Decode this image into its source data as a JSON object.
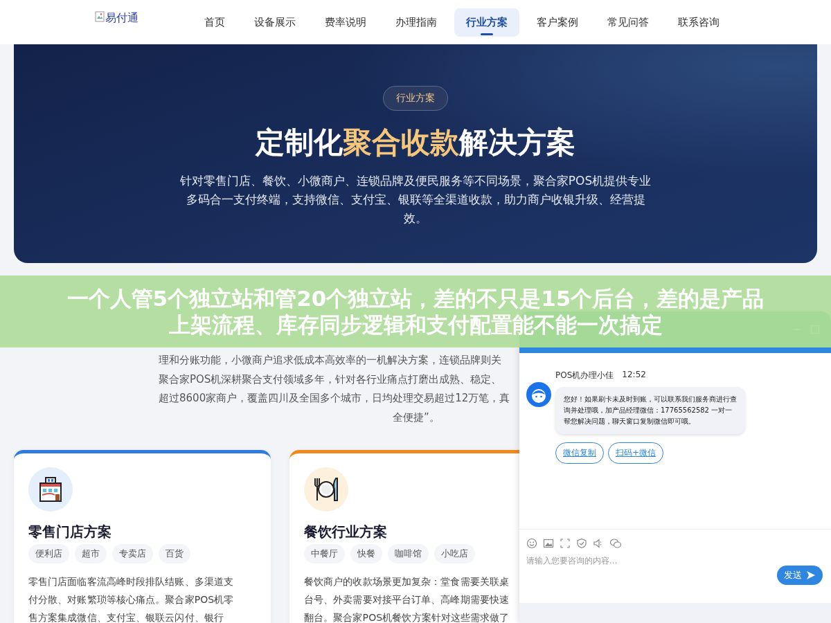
{
  "nav": {
    "logo": "易付通",
    "items": [
      {
        "label": "首页",
        "selected": false
      },
      {
        "label": "设备展示",
        "selected": false
      },
      {
        "label": "费率说明",
        "selected": false
      },
      {
        "label": "办理指南",
        "selected": false
      },
      {
        "label": "行业方案",
        "selected": true
      },
      {
        "label": "客户案例",
        "selected": false
      },
      {
        "label": "常见问答",
        "selected": false
      },
      {
        "label": "联系咨询",
        "selected": false
      }
    ]
  },
  "hero": {
    "badge": "行业方案",
    "title": {
      "before": "定制化",
      "highlight": "聚合收款",
      "after": "解决方案"
    },
    "description": "针对零售门店、餐饮、小微商户、连锁品牌及便民服务等不同场景，聚合家POS机提供专业多码合一支付终端，支持微信、支付宝、银联等全渠道收款，助力商户收银升级、经营提效。"
  },
  "intro": {
    "lines": [
      "理和分账功能，小微商户追求低成本高效率的一机解决方案，连锁品牌则关",
      "聚合家POS机深耕聚合支付领域多年，针对各行业痛点打磨出成熟、稳定、",
      "超过8600家商户，覆盖四川及全国多个城市，日均处理交易超过12万笔，真",
      "全便捷”。"
    ]
  },
  "cards": [
    {
      "kind": "retail",
      "color": "#2f7be0",
      "title": "零售门店方案",
      "tags": [
        "便利店",
        "超市",
        "专卖店",
        "百货"
      ],
      "lines": [
        "零售门店面临客流高峰时段排队结账、多渠道支",
        "付分散、对账繁琐等核心痛点。聚合家POS机零",
        "售方案集成微信、支付宝、银联云闪付、银行"
      ]
    },
    {
      "kind": "dining",
      "color": "#f08a1c",
      "title": "餐饮行业方案",
      "tags": [
        "中餐厅",
        "快餐",
        "咖啡馆",
        "小吃店"
      ],
      "lines": [
        "餐饮商户的收款场景更加复杂：堂食需要关联桌",
        "台号、外卖需要对接平台订单、高峰期需要快速",
        "翻台。聚合家POS机餐饮方案针对这些需求做了"
      ]
    }
  ],
  "chat": {
    "agent": "POS机办理小佳",
    "time": "12:52",
    "message": "您好！如果刷卡未及时到账，可以联系我们服务商进行查询并处理哦，加产品经理微信：17765562582 一对一帮您解决问题，聊天窗口复制微信即可哦。",
    "actions": [
      "微信复制",
      "扫码+微信"
    ],
    "input": {
      "placeholder": "请输入您要咨询的内容..."
    },
    "send": "发送"
  },
  "caption": {
    "lines": [
      "一个人管5个独立站和管20个独立站，差的不只是15个后台，差的是产品",
      "上架流程、库存同步逻辑和支付配置能不能一次搞定"
    ]
  }
}
